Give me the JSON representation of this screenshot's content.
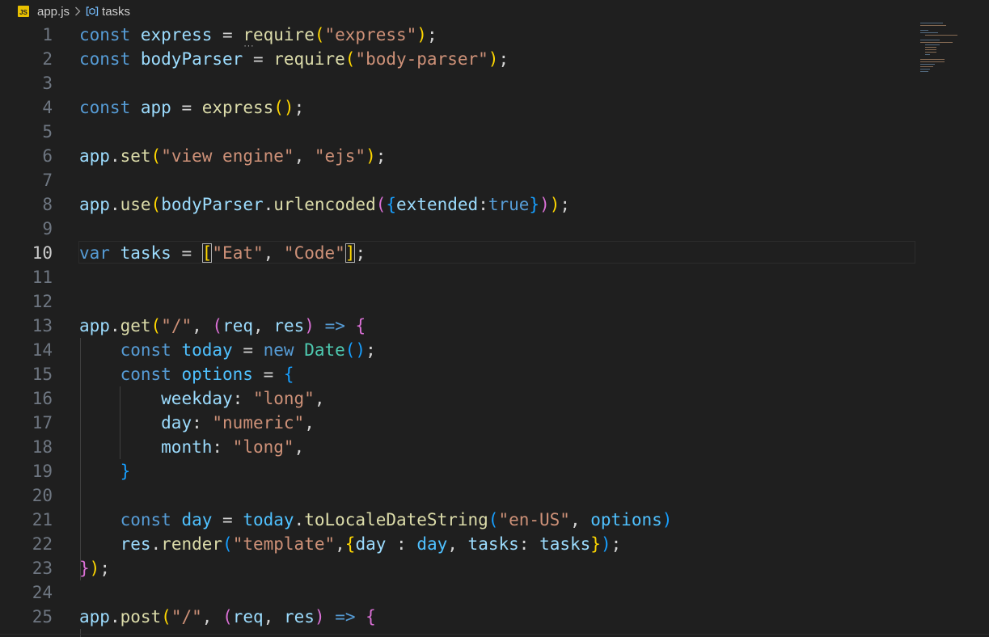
{
  "breadcrumb": {
    "file_icon_label": "JS",
    "file_name": "app.js",
    "separator_icon": "chevron-right-icon",
    "symbol_icon": "variable-symbol-icon",
    "symbol_name": "tasks"
  },
  "editor": {
    "active_line": "10",
    "lines": [
      {
        "n": "1",
        "tokens": [
          {
            "t": "const",
            "c": "k"
          },
          {
            "t": " "
          },
          {
            "t": "express",
            "c": "v"
          },
          {
            "t": " = ",
            "c": "p"
          },
          {
            "t": "r",
            "c": "f"
          },
          {
            "t": "equire",
            "c": "f"
          },
          {
            "t": "(",
            "c": "b1"
          },
          {
            "t": "\"express\"",
            "c": "s"
          },
          {
            "t": ")",
            "c": "b1"
          },
          {
            "t": ";",
            "c": "p"
          }
        ]
      },
      {
        "n": "2",
        "tokens": [
          {
            "t": "const",
            "c": "k"
          },
          {
            "t": " "
          },
          {
            "t": "bodyParser",
            "c": "v"
          },
          {
            "t": " = ",
            "c": "p"
          },
          {
            "t": "require",
            "c": "f"
          },
          {
            "t": "(",
            "c": "b1"
          },
          {
            "t": "\"body-parser\"",
            "c": "s"
          },
          {
            "t": ")",
            "c": "b1"
          },
          {
            "t": ";",
            "c": "p"
          }
        ]
      },
      {
        "n": "3",
        "tokens": []
      },
      {
        "n": "4",
        "tokens": [
          {
            "t": "const",
            "c": "k"
          },
          {
            "t": " "
          },
          {
            "t": "app",
            "c": "v"
          },
          {
            "t": " = ",
            "c": "p"
          },
          {
            "t": "express",
            "c": "f"
          },
          {
            "t": "()",
            "c": "b1"
          },
          {
            "t": ";",
            "c": "p"
          }
        ]
      },
      {
        "n": "5",
        "tokens": []
      },
      {
        "n": "6",
        "tokens": [
          {
            "t": "app",
            "c": "v"
          },
          {
            "t": ".",
            "c": "p"
          },
          {
            "t": "set",
            "c": "f"
          },
          {
            "t": "(",
            "c": "b1"
          },
          {
            "t": "\"view engine\"",
            "c": "s"
          },
          {
            "t": ", ",
            "c": "p"
          },
          {
            "t": "\"ejs\"",
            "c": "s"
          },
          {
            "t": ")",
            "c": "b1"
          },
          {
            "t": ";",
            "c": "p"
          }
        ]
      },
      {
        "n": "7",
        "tokens": []
      },
      {
        "n": "8",
        "tokens": [
          {
            "t": "app",
            "c": "v"
          },
          {
            "t": ".",
            "c": "p"
          },
          {
            "t": "use",
            "c": "f"
          },
          {
            "t": "(",
            "c": "b1"
          },
          {
            "t": "bodyParser",
            "c": "v"
          },
          {
            "t": ".",
            "c": "p"
          },
          {
            "t": "urlencoded",
            "c": "f"
          },
          {
            "t": "(",
            "c": "b2"
          },
          {
            "t": "{",
            "c": "b3"
          },
          {
            "t": "extended",
            "c": "v"
          },
          {
            "t": ":",
            "c": "p"
          },
          {
            "t": "true",
            "c": "k"
          },
          {
            "t": "}",
            "c": "b3"
          },
          {
            "t": ")",
            "c": "b2"
          },
          {
            "t": ")",
            "c": "b1"
          },
          {
            "t": ";",
            "c": "p"
          }
        ]
      },
      {
        "n": "9",
        "tokens": []
      },
      {
        "n": "10",
        "tokens": [
          {
            "t": "var",
            "c": "k"
          },
          {
            "t": " "
          },
          {
            "t": "tasks",
            "c": "v"
          },
          {
            "t": " = ",
            "c": "p"
          },
          {
            "t": "[",
            "c": "b1 bm"
          },
          {
            "t": "\"Eat\"",
            "c": "s"
          },
          {
            "t": ", ",
            "c": "p"
          },
          {
            "t": "\"Code\"",
            "c": "s"
          },
          {
            "t": "]",
            "c": "b1 bm"
          },
          {
            "t": ";",
            "c": "p"
          }
        ]
      },
      {
        "n": "11",
        "tokens": []
      },
      {
        "n": "12",
        "tokens": []
      },
      {
        "n": "13",
        "tokens": [
          {
            "t": "app",
            "c": "v"
          },
          {
            "t": ".",
            "c": "p"
          },
          {
            "t": "get",
            "c": "f"
          },
          {
            "t": "(",
            "c": "b1"
          },
          {
            "t": "\"/\"",
            "c": "s"
          },
          {
            "t": ", ",
            "c": "p"
          },
          {
            "t": "(",
            "c": "b2"
          },
          {
            "t": "req",
            "c": "v"
          },
          {
            "t": ", ",
            "c": "p"
          },
          {
            "t": "res",
            "c": "v"
          },
          {
            "t": ")",
            "c": "b2"
          },
          {
            "t": " ",
            "c": "p"
          },
          {
            "t": "=>",
            "c": "k"
          },
          {
            "t": " ",
            "c": "p"
          },
          {
            "t": "{",
            "c": "b2"
          }
        ]
      },
      {
        "n": "14",
        "tokens": [
          {
            "t": "    "
          },
          {
            "t": "const",
            "c": "k"
          },
          {
            "t": " "
          },
          {
            "t": "today",
            "c": "c"
          },
          {
            "t": " = ",
            "c": "p"
          },
          {
            "t": "new",
            "c": "k"
          },
          {
            "t": " "
          },
          {
            "t": "Date",
            "c": "t"
          },
          {
            "t": "()",
            "c": "b3"
          },
          {
            "t": ";",
            "c": "p"
          }
        ]
      },
      {
        "n": "15",
        "tokens": [
          {
            "t": "    "
          },
          {
            "t": "const",
            "c": "k"
          },
          {
            "t": " "
          },
          {
            "t": "options",
            "c": "c"
          },
          {
            "t": " = ",
            "c": "p"
          },
          {
            "t": "{",
            "c": "b3"
          }
        ]
      },
      {
        "n": "16",
        "tokens": [
          {
            "t": "        "
          },
          {
            "t": "weekday",
            "c": "v"
          },
          {
            "t": ": ",
            "c": "p"
          },
          {
            "t": "\"long\"",
            "c": "s"
          },
          {
            "t": ",",
            "c": "p"
          }
        ]
      },
      {
        "n": "17",
        "tokens": [
          {
            "t": "        "
          },
          {
            "t": "day",
            "c": "v"
          },
          {
            "t": ": ",
            "c": "p"
          },
          {
            "t": "\"numeric\"",
            "c": "s"
          },
          {
            "t": ",",
            "c": "p"
          }
        ]
      },
      {
        "n": "18",
        "tokens": [
          {
            "t": "        "
          },
          {
            "t": "month",
            "c": "v"
          },
          {
            "t": ": ",
            "c": "p"
          },
          {
            "t": "\"long\"",
            "c": "s"
          },
          {
            "t": ",",
            "c": "p"
          }
        ]
      },
      {
        "n": "19",
        "tokens": [
          {
            "t": "    "
          },
          {
            "t": "}",
            "c": "b3"
          }
        ]
      },
      {
        "n": "20",
        "tokens": []
      },
      {
        "n": "21",
        "tokens": [
          {
            "t": "    "
          },
          {
            "t": "const",
            "c": "k"
          },
          {
            "t": " "
          },
          {
            "t": "day",
            "c": "c"
          },
          {
            "t": " = ",
            "c": "p"
          },
          {
            "t": "today",
            "c": "c"
          },
          {
            "t": ".",
            "c": "p"
          },
          {
            "t": "toLocaleDateString",
            "c": "f"
          },
          {
            "t": "(",
            "c": "b3"
          },
          {
            "t": "\"en-US\"",
            "c": "s"
          },
          {
            "t": ", ",
            "c": "p"
          },
          {
            "t": "options",
            "c": "c"
          },
          {
            "t": ")",
            "c": "b3"
          }
        ]
      },
      {
        "n": "22",
        "tokens": [
          {
            "t": "    "
          },
          {
            "t": "res",
            "c": "v"
          },
          {
            "t": ".",
            "c": "p"
          },
          {
            "t": "render",
            "c": "f"
          },
          {
            "t": "(",
            "c": "b3"
          },
          {
            "t": "\"template\"",
            "c": "s"
          },
          {
            "t": ",",
            "c": "p"
          },
          {
            "t": "{",
            "c": "b1"
          },
          {
            "t": "day",
            "c": "v"
          },
          {
            "t": " : ",
            "c": "p"
          },
          {
            "t": "day",
            "c": "c"
          },
          {
            "t": ", ",
            "c": "p"
          },
          {
            "t": "tasks",
            "c": "v"
          },
          {
            "t": ": ",
            "c": "p"
          },
          {
            "t": "tasks",
            "c": "v"
          },
          {
            "t": "}",
            "c": "b1"
          },
          {
            "t": ")",
            "c": "b3"
          },
          {
            "t": ";",
            "c": "p"
          }
        ]
      },
      {
        "n": "23",
        "tokens": [
          {
            "t": "}",
            "c": "b2"
          },
          {
            "t": ")",
            "c": "b1"
          },
          {
            "t": ";",
            "c": "p"
          }
        ]
      },
      {
        "n": "24",
        "tokens": []
      },
      {
        "n": "25",
        "tokens": [
          {
            "t": "app",
            "c": "v"
          },
          {
            "t": ".",
            "c": "p"
          },
          {
            "t": "post",
            "c": "f"
          },
          {
            "t": "(",
            "c": "b1"
          },
          {
            "t": "\"/\"",
            "c": "s"
          },
          {
            "t": ", ",
            "c": "p"
          },
          {
            "t": "(",
            "c": "b2"
          },
          {
            "t": "req",
            "c": "v"
          },
          {
            "t": ", ",
            "c": "p"
          },
          {
            "t": "res",
            "c": "v"
          },
          {
            "t": ")",
            "c": "b2"
          },
          {
            "t": " ",
            "c": "p"
          },
          {
            "t": "=>",
            "c": "k"
          },
          {
            "t": " ",
            "c": "p"
          },
          {
            "t": "{",
            "c": "b2"
          }
        ]
      }
    ]
  },
  "colors": {
    "background": "#1f1f1f",
    "keyword": "#569cd6",
    "variable": "#9cdcfe",
    "constant": "#4fc1ff",
    "function": "#dcdcaa",
    "string": "#ce9178",
    "type": "#4ec9b0",
    "bracket_1": "#ffd700",
    "bracket_2": "#da70d6",
    "bracket_3": "#179fff"
  }
}
